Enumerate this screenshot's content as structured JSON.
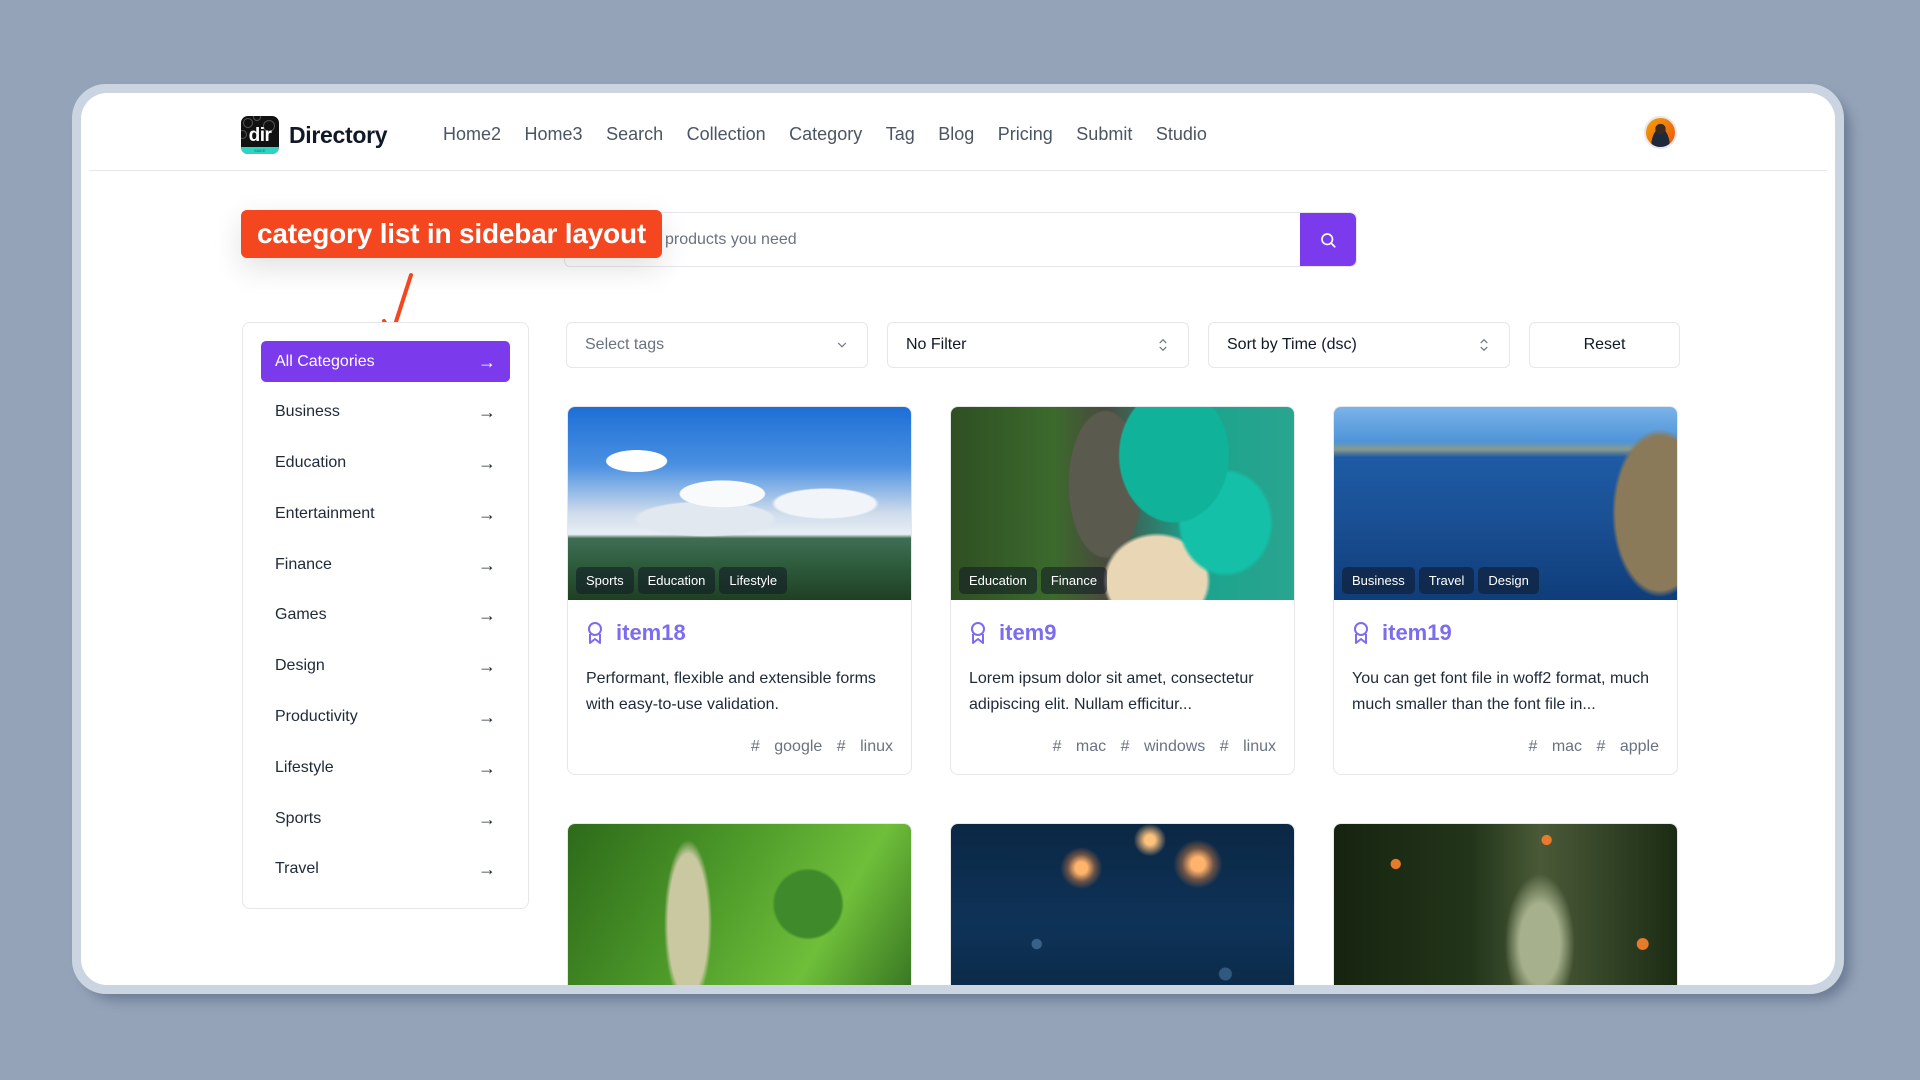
{
  "app": {
    "logo_mark": "dir",
    "logo_strip": "MAKE",
    "name": "Directory"
  },
  "nav": {
    "items": [
      "Home2",
      "Home3",
      "Search",
      "Collection",
      "Category",
      "Tag",
      "Blog",
      "Pricing",
      "Submit",
      "Studio"
    ]
  },
  "user": {
    "avatar": "user-avatar"
  },
  "search": {
    "placeholder": "products you need",
    "button_icon": "search-icon"
  },
  "annotation": {
    "label": "category list in sidebar layout",
    "color": "#f4461f"
  },
  "sidebar": {
    "items": [
      {
        "label": "All Categories",
        "active": true
      },
      {
        "label": "Business"
      },
      {
        "label": "Education"
      },
      {
        "label": "Entertainment"
      },
      {
        "label": "Finance"
      },
      {
        "label": "Games"
      },
      {
        "label": "Design"
      },
      {
        "label": "Productivity"
      },
      {
        "label": "Lifestyle"
      },
      {
        "label": "Sports"
      },
      {
        "label": "Travel"
      }
    ]
  },
  "filters": {
    "tags_placeholder": "Select tags",
    "filter_value": "No Filter",
    "sort_value": "Sort by Time (dsc)",
    "reset_label": "Reset"
  },
  "theme": {
    "accent": "#7c3aed",
    "title_color": "#7c6cf0",
    "page_bg": "#94a3b8"
  },
  "cards": [
    {
      "title": "item18",
      "image": "mountain-landscape",
      "categories": [
        "Sports",
        "Education",
        "Lifestyle"
      ],
      "description": "Performant, flexible and extensible forms with easy-to-use validation.",
      "tags": [
        "google",
        "linux"
      ]
    },
    {
      "title": "item9",
      "image": "tropical-beach",
      "categories": [
        "Education",
        "Finance"
      ],
      "description": "Lorem ipsum dolor sit amet, consectetur adipiscing elit. Nullam efficitur...",
      "tags": [
        "mac",
        "windows",
        "linux"
      ]
    },
    {
      "title": "item19",
      "image": "coastal-sea-cliffs",
      "categories": [
        "Business",
        "Travel",
        "Design"
      ],
      "description": "You can get font file in woff2 format, much much smaller than the font file in...",
      "tags": [
        "mac",
        "apple"
      ]
    },
    {
      "image": "green-aerial-field"
    },
    {
      "image": "sparklers"
    },
    {
      "image": "orange-tree"
    }
  ]
}
